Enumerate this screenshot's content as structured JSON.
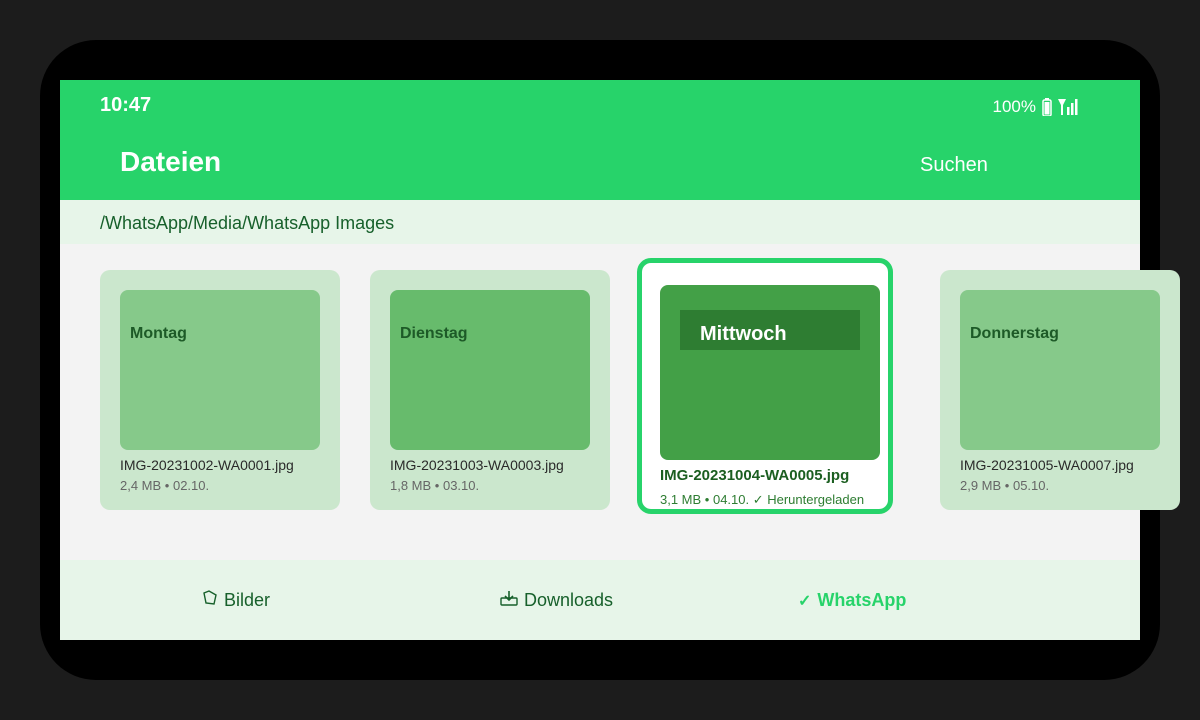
{
  "status": {
    "time": "10:47",
    "battery": "100%",
    "battery_icon": "battery-icon",
    "signal_icon": "signal-icon"
  },
  "appbar": {
    "title": "Dateien",
    "search_label": "Suchen",
    "color": "#27d36a"
  },
  "path": "/WhatsApp/Media/WhatsApp Images",
  "files": [
    {
      "thumb_label": "Montag",
      "name": "IMG-20231002-WA0001.jpg",
      "meta": "2,4 MB • 02.10."
    },
    {
      "thumb_label": "Dienstag",
      "name": "IMG-20231003-WA0003.jpg",
      "meta": "1,8 MB • 03.10."
    },
    {
      "thumb_label": "Mittwoch",
      "name": "IMG-20231004-WA0005.jpg",
      "meta": "3,1 MB • 04.10. ✓ Heruntergeladen",
      "selected": true
    },
    {
      "thumb_label": "Donnerstag",
      "name": "IMG-20231005-WA0007.jpg",
      "meta": "2,9 MB • 05.10."
    }
  ],
  "bottomnav": {
    "items": [
      {
        "icon": "📁",
        "icon_name": "folder-icon",
        "label": "Bilder"
      },
      {
        "icon": "📥",
        "icon_name": "download-tray-icon",
        "label": "Downloads"
      },
      {
        "icon": "✓",
        "icon_name": "checkmark-icon",
        "label": "WhatsApp",
        "active": true
      }
    ]
  }
}
